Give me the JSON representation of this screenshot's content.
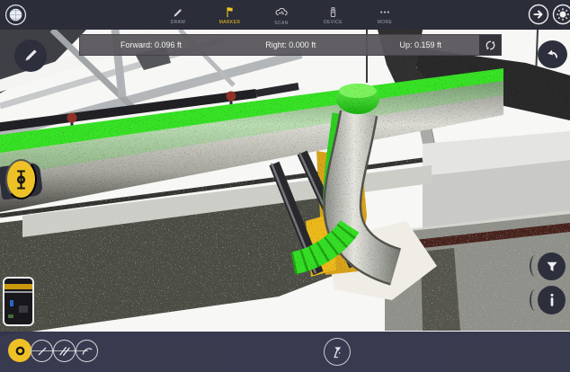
{
  "top_bar": {
    "nav_items": [
      {
        "id": "draw",
        "label": "DRAW",
        "icon": "pencil-icon",
        "active": false
      },
      {
        "id": "marker",
        "label": "MARKER",
        "icon": "flag-icon",
        "active": true
      },
      {
        "id": "scan",
        "label": "SCAN",
        "icon": "scan-cloud-icon",
        "active": false
      },
      {
        "id": "device",
        "label": "DEVICE",
        "icon": "device-icon",
        "active": false
      },
      {
        "id": "more",
        "label": "MORE",
        "icon": "more-dots-icon",
        "active": false
      }
    ]
  },
  "measure_bar": {
    "forward": "Forward: 0.096 ft",
    "right": "Right: 0.000 ft",
    "up": "0.159 ft",
    "up_full": "Up: 0.159 ft"
  },
  "colors": {
    "accent_gold": "#eec227",
    "highlight_green": "#38e226",
    "top_bar_bg": "#2b2d39",
    "bottom_bar_bg": "#323449",
    "measure_bar_bg": "#58565b",
    "circle_button_bg": "#2d2f3d",
    "red_fitting": "#93302b"
  },
  "icons": {
    "globe-icon": "panorama sphere",
    "pencil-icon": "pencil",
    "flag-icon": "flag",
    "scan-cloud-icon": "point-cloud cluster",
    "device-icon": "scanner device with signal waves",
    "more-dots-icon": "ellipsis",
    "forward-arrow-icon": "right arrow in ring",
    "sun-icon": "brightness burst",
    "undo-icon": "curved back arrow",
    "draw-tool-icon": "diagonal pencil",
    "vertical-move-icon": "vertical double arrow with center ring",
    "filter-icon": "funnel",
    "info-icon": "letter i",
    "sync-icon": "circular refresh arrows",
    "point-tool-icon": "ring",
    "line-tool-icon": "single slash",
    "parallel-tool-icon": "double slash",
    "arc-tool-icon": "curve",
    "scanner-tool-icon": "tripod scanner"
  },
  "scene": {
    "description": "3D laser-scan point cloud of ceiling piping; measured pipe run highlighted green, yellow fittings, grey insulated pipes, white ceiling with steel framing",
    "highlighted_pipe_color": "#38e226",
    "fitting_color": "#d9a41a"
  }
}
